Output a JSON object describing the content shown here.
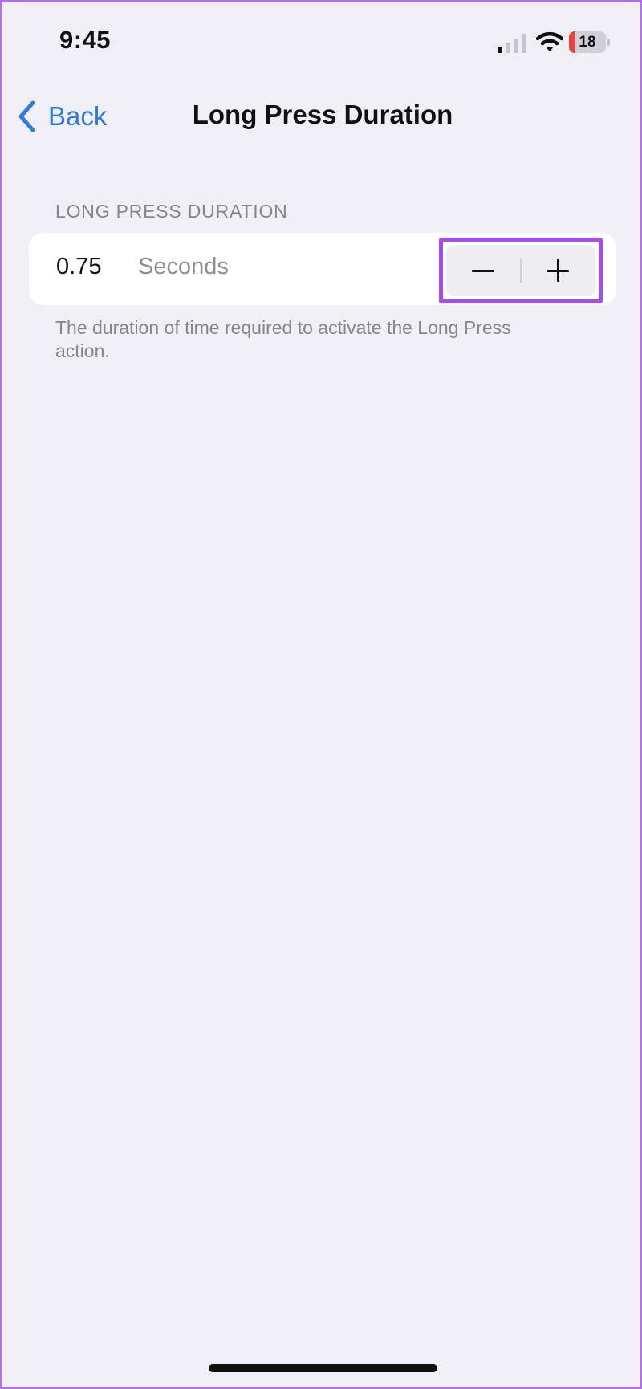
{
  "status_bar": {
    "time": "9:45",
    "signal_icon": "cellular-signal-icon",
    "wifi_icon": "wifi-icon",
    "battery_level": "18",
    "battery_fraction": 0.18,
    "battery_color": "#e8443f"
  },
  "nav": {
    "back_label": "Back",
    "back_icon": "chevron-left-icon",
    "title": "Long Press Duration"
  },
  "section": {
    "header": "LONG PRESS DURATION",
    "value": "0.75",
    "unit": "Seconds",
    "decrement_icon": "minus-icon",
    "increment_icon": "plus-icon",
    "highlight_color": "#a54cf1",
    "footer": "The duration of time required to activate the Long Press action."
  },
  "colors": {
    "accent": "#2f7be0",
    "background": "#f0eff6"
  }
}
